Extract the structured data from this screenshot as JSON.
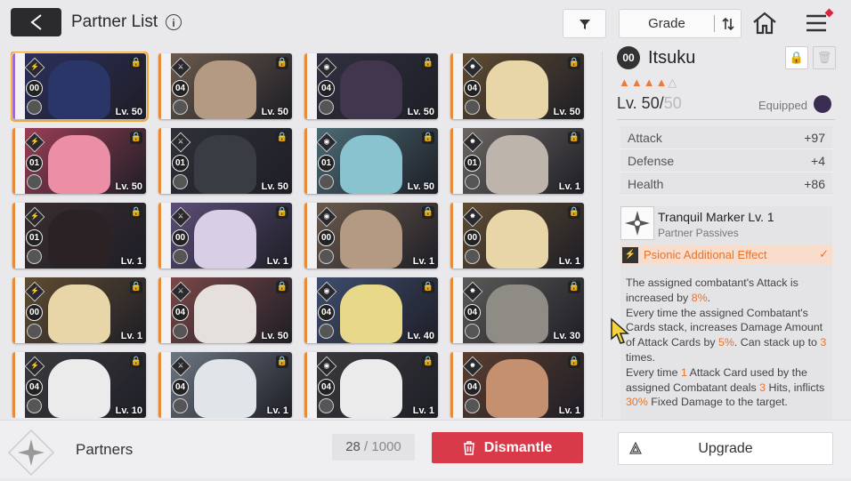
{
  "header": {
    "title": "Partner List",
    "info_icon": "i",
    "grade_label": "Grade"
  },
  "cards": [
    {
      "num": "00",
      "lv": "Lv. 50",
      "rarity": "#9e6ad6",
      "bg": "#2c2f5c",
      "face": "#2b3668",
      "selected": true
    },
    {
      "num": "04",
      "lv": "Lv. 50",
      "rarity": "#e88b36",
      "bg": "#6a5a4c",
      "face": "#b49a82",
      "selected": false
    },
    {
      "num": "04",
      "lv": "Lv. 50",
      "rarity": "#e88b36",
      "bg": "#303040",
      "face": "#41364e",
      "selected": false
    },
    {
      "num": "04",
      "lv": "Lv. 50",
      "rarity": "#e88b36",
      "bg": "#5f4c32",
      "face": "#e9d6a8",
      "selected": false
    },
    {
      "num": "01",
      "lv": "Lv. 50",
      "rarity": "#e88b36",
      "bg": "#9a3e56",
      "face": "#ec8fa6",
      "selected": false
    },
    {
      "num": "01",
      "lv": "Lv. 50",
      "rarity": "#e88b36",
      "bg": "#2e3138",
      "face": "#3a3c43",
      "selected": false
    },
    {
      "num": "01",
      "lv": "Lv. 50",
      "rarity": "#e88b36",
      "bg": "#4b6a74",
      "face": "#88c3cf",
      "selected": false
    },
    {
      "num": "01",
      "lv": "Lv. 1",
      "rarity": "#e88b36",
      "bg": "#6b6662",
      "face": "#bdb5ab",
      "selected": false
    },
    {
      "num": "01",
      "lv": "Lv. 1",
      "rarity": "#e88b36",
      "bg": "#3a2e30",
      "face": "#2a2224",
      "selected": false
    },
    {
      "num": "00",
      "lv": "Lv. 1",
      "rarity": "#e88b36",
      "bg": "#5b4e78",
      "face": "#d8cfe6",
      "selected": false
    },
    {
      "num": "00",
      "lv": "Lv. 1",
      "rarity": "#e88b36",
      "bg": "#6a5a4c",
      "face": "#b49a82",
      "selected": false
    },
    {
      "num": "00",
      "lv": "Lv. 1",
      "rarity": "#e88b36",
      "bg": "#5f4c32",
      "face": "#e9d6a8",
      "selected": false
    },
    {
      "num": "00",
      "lv": "Lv. 1",
      "rarity": "#e88b36",
      "bg": "#5f4c32",
      "face": "#e9d6a8",
      "selected": false
    },
    {
      "num": "04",
      "lv": "Lv. 50",
      "rarity": "#e88b36",
      "bg": "#7a4848",
      "face": "#e6e0dc",
      "selected": false
    },
    {
      "num": "04",
      "lv": "Lv. 40",
      "rarity": "#e88b36",
      "bg": "#3e4d6e",
      "face": "#e8d88a",
      "selected": false
    },
    {
      "num": "04",
      "lv": "Lv. 30",
      "rarity": "#e88b36",
      "bg": "#5a5a58",
      "face": "#8e8c84",
      "selected": false
    },
    {
      "num": "04",
      "lv": "Lv. 10",
      "rarity": "#e88b36",
      "bg": "#3a3a3e",
      "face": "#ebebeb",
      "selected": false
    },
    {
      "num": "04",
      "lv": "Lv. 1",
      "rarity": "#e88b36",
      "bg": "#6c7682",
      "face": "#e1e5ea",
      "selected": false
    },
    {
      "num": "04",
      "lv": "Lv. 1",
      "rarity": "#e88b36",
      "bg": "#3a3a3e",
      "face": "#ebebeb",
      "selected": false
    },
    {
      "num": "04",
      "lv": "Lv. 1",
      "rarity": "#e88b36",
      "bg": "#5a3e30",
      "face": "#c49070",
      "selected": false
    }
  ],
  "detail": {
    "badge": "00",
    "name": "Itsuku",
    "stars_on": 4,
    "stars_total": 5,
    "level": "Lv. 50/",
    "level_max": "50",
    "equipped_label": "Equipped",
    "stats": [
      {
        "key": "Attack",
        "value": "+97"
      },
      {
        "key": "Defense",
        "value": "+4"
      },
      {
        "key": "Health",
        "value": "+86"
      }
    ],
    "passive_name": "Tranquil Marker Lv. 1",
    "passive_sub": "Partner Passives",
    "psionic_label": "Psionic Additional Effect",
    "desc": [
      [
        "The assigned combatant's Attack is increased by ",
        "8%",
        "."
      ],
      [
        "Every time the assigned Combatant's Cards stack, increases Damage Amount of Attack Cards by ",
        "5%",
        ". Can stack up to ",
        "3",
        " times."
      ],
      [
        "Every time ",
        "1",
        " Attack Card used by the assigned Combatant deals ",
        "3",
        " Hits, inflicts ",
        "30%",
        " Fixed Damage to the target."
      ]
    ]
  },
  "footer": {
    "partners_label": "Partners",
    "count_current": "28",
    "count_sep": " / ",
    "count_max": "1000",
    "dismantle_label": "Dismantle",
    "upgrade_label": "Upgrade"
  },
  "colors": {
    "accent": "#f0a83a",
    "danger": "#d93a49",
    "orange_text": "#e5742f"
  }
}
